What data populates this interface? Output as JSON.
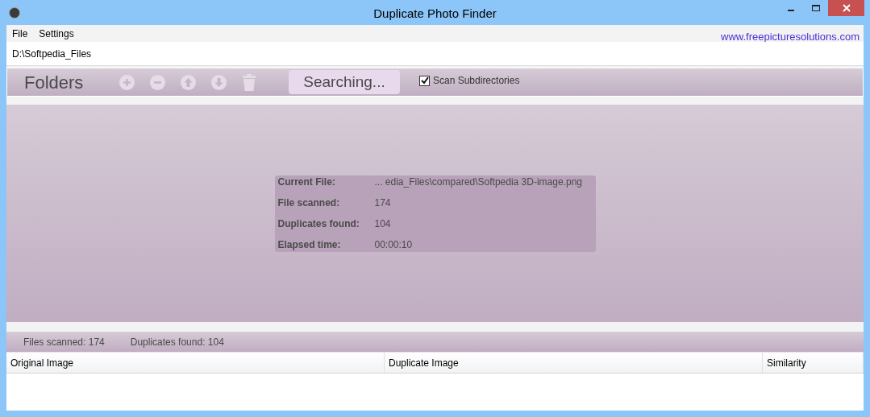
{
  "window": {
    "title": "Duplicate Photo Finder"
  },
  "menu": [
    "File",
    "Settings"
  ],
  "website_link": "www.freepicturesolutions.com",
  "folder_path": "D:\\Softpedia_Files",
  "toolbar": {
    "title": "Folders",
    "search_button": "Searching...",
    "scan_subdirectories": {
      "label": "Scan Subdirectories",
      "checked": true
    }
  },
  "progress": [
    {
      "label": "Current File:",
      "value": "... edia_Files\\compared\\Softpedia 3D-image.png"
    },
    {
      "label": "File scanned:",
      "value": "174"
    },
    {
      "label": "Duplicates found:",
      "value": "104"
    },
    {
      "label": "Elapsed time:",
      "value": "00:00:10"
    }
  ],
  "status_bar": [
    "Files scanned: 174",
    "Duplicates found: 104"
  ],
  "table": {
    "columns": [
      "Original Image",
      "Duplicate Image",
      "Similarity"
    ]
  }
}
